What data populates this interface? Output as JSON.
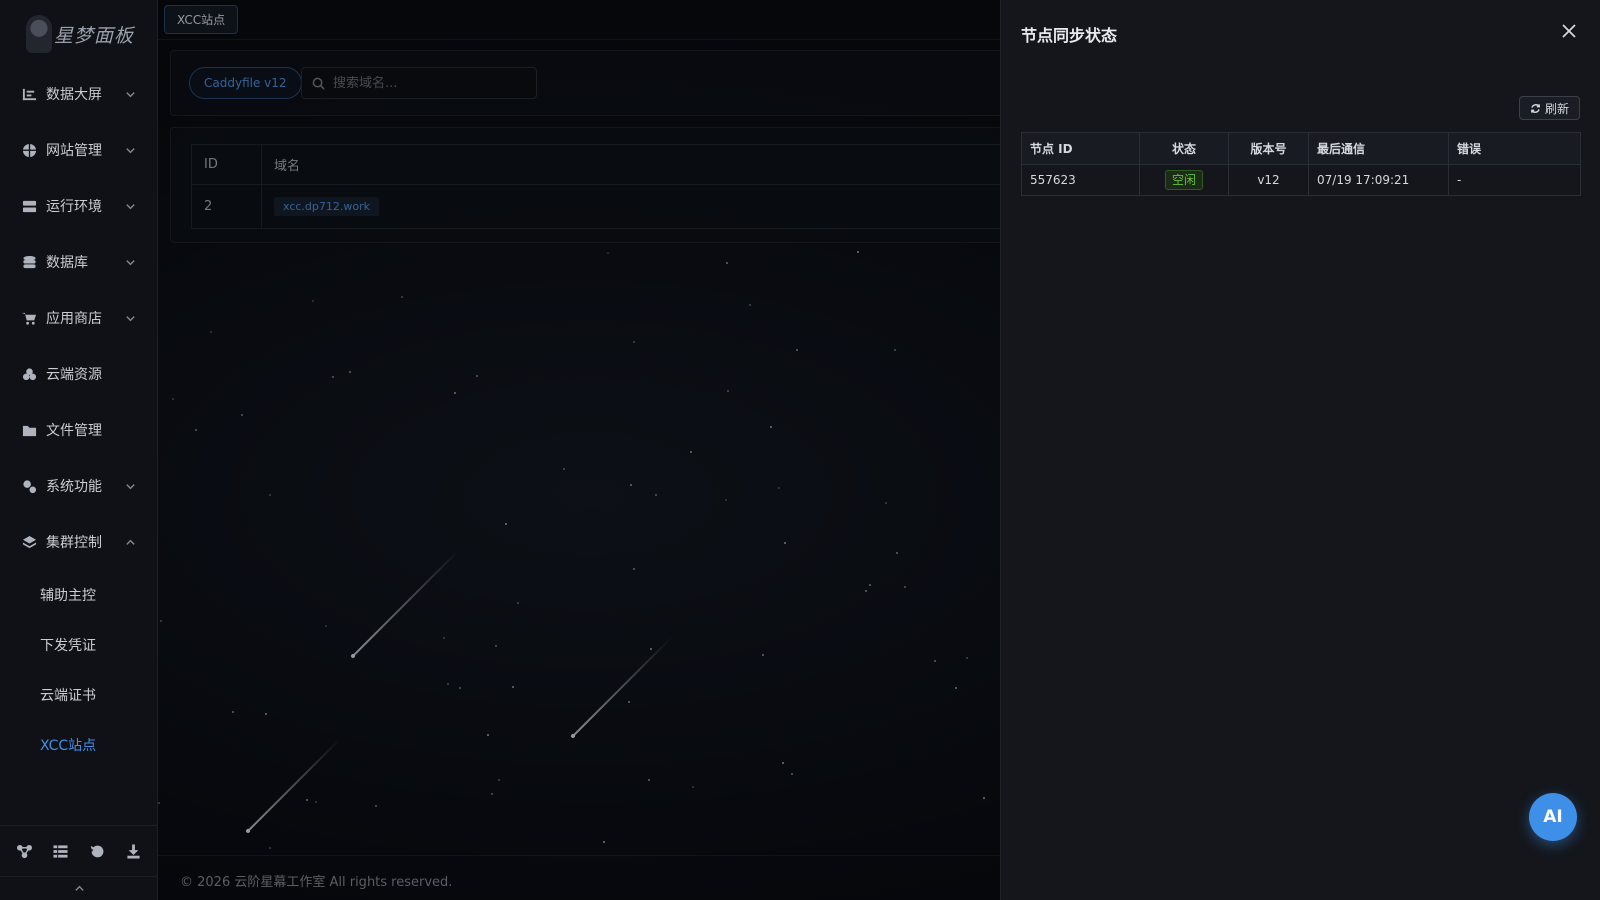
{
  "app": {
    "logo_text": "星梦面板"
  },
  "sidebar": {
    "items": [
      {
        "label": "数据大屏",
        "icon": "chart-icon",
        "expandable": true
      },
      {
        "label": "网站管理",
        "icon": "globe-icon",
        "expandable": true
      },
      {
        "label": "运行环境",
        "icon": "server-icon",
        "expandable": true
      },
      {
        "label": "数据库",
        "icon": "database-icon",
        "expandable": true
      },
      {
        "label": "应用商店",
        "icon": "cart-icon",
        "expandable": true
      },
      {
        "label": "云端资源",
        "icon": "cloud-icon",
        "expandable": false
      },
      {
        "label": "文件管理",
        "icon": "folder-icon",
        "expandable": false
      },
      {
        "label": "系统功能",
        "icon": "gears-icon",
        "expandable": true
      },
      {
        "label": "集群控制",
        "icon": "layers-icon",
        "expandable": true,
        "expanded": true
      }
    ],
    "submenu": [
      {
        "label": "辅助主控",
        "active": false
      },
      {
        "label": "下发凭证",
        "active": false
      },
      {
        "label": "云端证书",
        "active": false
      },
      {
        "label": "XCC站点",
        "active": true
      }
    ],
    "footer_icons": [
      "cluster-icon",
      "list-icon",
      "history-icon",
      "download-icon"
    ]
  },
  "tabs": [
    {
      "label": "XCC站点",
      "active": true
    }
  ],
  "toolbar": {
    "version_pill": "Caddyfile v12",
    "search_placeholder": "搜索域名..."
  },
  "domain_table": {
    "columns": [
      "ID",
      "域名"
    ],
    "rows": [
      {
        "id": "2",
        "domain": "xcc.dp712.work"
      }
    ]
  },
  "footer": {
    "copyright": "© 2026 云阶星幕工作室 All rights reserved."
  },
  "drawer": {
    "title": "节点同步状态",
    "refresh_label": "刷新",
    "columns": [
      "节点 ID",
      "状态",
      "版本号",
      "最后通信",
      "错误"
    ],
    "rows": [
      {
        "node_id": "557623",
        "status": "空闲",
        "version": "v12",
        "last_contact": "07/19 17:09:21",
        "error": "-"
      }
    ]
  },
  "ai_button": {
    "label": "AI"
  },
  "colors": {
    "accent": "#3d8fe8",
    "status_idle": "#67c23a",
    "sidebar_bg": "#0f1116",
    "drawer_bg": "#14161b"
  }
}
